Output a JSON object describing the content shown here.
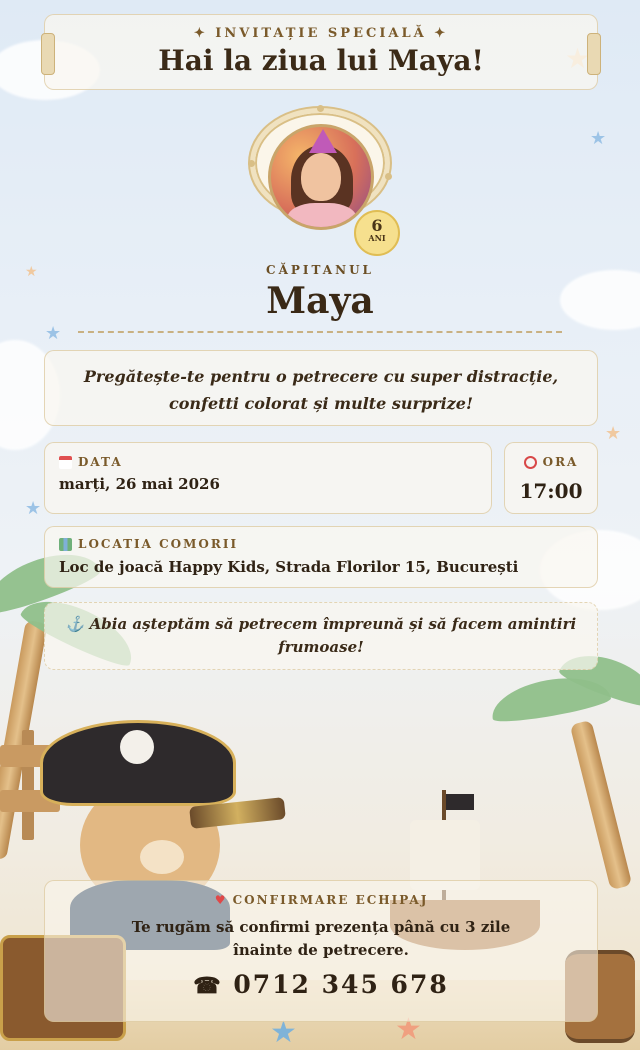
{
  "header": {
    "kicker": "✦ INVITAȚIE SPECIALĂ ✦",
    "title": "Hai la ziua lui Maya!"
  },
  "age": {
    "number": "6",
    "unit": "ANI"
  },
  "captain": {
    "label": "CĂPITANUL",
    "name": "Maya"
  },
  "intro": "Pregătește-te pentru o petrecere cu super distracție, confetti colorat și multe surprize!",
  "date": {
    "label": "DATA",
    "value": "marți, 26 mai 2026"
  },
  "time": {
    "label": "ORA",
    "value": "17:00"
  },
  "location": {
    "label": "LOCATIA COMORII",
    "value": "Loc de joacă Happy Kids, Strada Florilor 15, București"
  },
  "note": "⚓ Abia așteptăm să petrecem împreună și să facem amintiri frumoase!",
  "rsvp": {
    "label": "CONFIRMARE ECHIPAJ",
    "text": "Te rugăm să confirmi prezența până cu 3 zile înainte de petrecere.",
    "phone_icon": "☎",
    "phone": "0712 345 678"
  },
  "icons": {
    "calendar": "calendar-icon",
    "alarm": "alarm-clock-icon",
    "map": "map-icon",
    "heart": "heart-icon",
    "phone": "phone-icon"
  }
}
